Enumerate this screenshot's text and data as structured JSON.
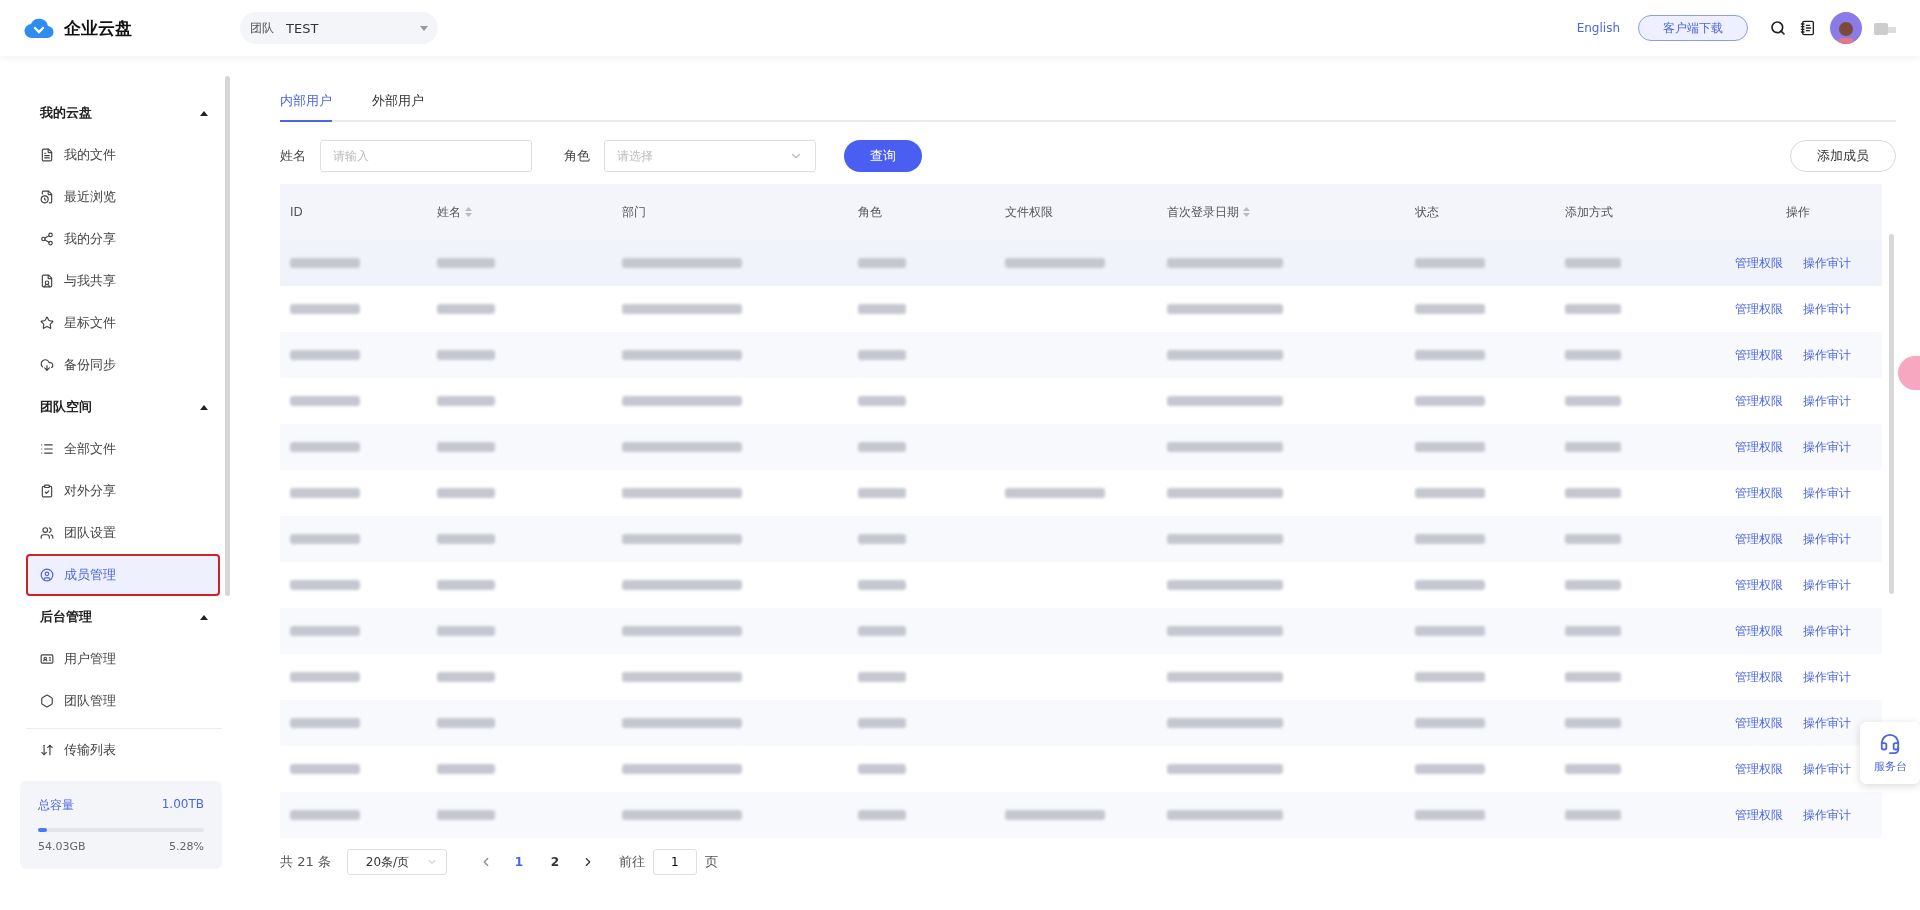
{
  "header": {
    "logo": "企业云盘",
    "team_label": "团队",
    "team_value": "TEST",
    "language": "English",
    "download": "客户端下载"
  },
  "sidebar": {
    "groups": [
      {
        "title": "我的云盘",
        "expanded": true,
        "items": [
          {
            "label": "我的文件",
            "selected": false
          },
          {
            "label": "最近浏览",
            "selected": false
          },
          {
            "label": "我的分享",
            "selected": false
          },
          {
            "label": "与我共享",
            "selected": false
          },
          {
            "label": "星标文件",
            "selected": false
          },
          {
            "label": "备份同步",
            "selected": false
          }
        ]
      },
      {
        "title": "团队空间",
        "expanded": true,
        "items": [
          {
            "label": "全部文件",
            "selected": false
          },
          {
            "label": "对外分享",
            "selected": false
          },
          {
            "label": "团队设置",
            "selected": false
          },
          {
            "label": "成员管理",
            "selected": true
          }
        ]
      },
      {
        "title": "后台管理",
        "expanded": true,
        "items": [
          {
            "label": "用户管理",
            "selected": false
          },
          {
            "label": "团队管理",
            "selected": false
          }
        ]
      }
    ],
    "transfer": "传输列表",
    "storage": {
      "label": "总容量",
      "total": "1.00TB",
      "used": "54.03GB",
      "percent": "5.28%",
      "level": 0.0528
    }
  },
  "tabs": [
    {
      "label": "内部用户",
      "selected": true
    },
    {
      "label": "外部用户",
      "selected": false
    }
  ],
  "filters": {
    "name_label": "姓名",
    "name_placeholder": "请输入",
    "role_label": "角色",
    "role_placeholder": "请选择",
    "search": "查询",
    "add": "添加成员"
  },
  "table": {
    "columns": [
      {
        "label": "ID",
        "sortable": false
      },
      {
        "label": "姓名",
        "sortable": true
      },
      {
        "label": "部门",
        "sortable": false
      },
      {
        "label": "角色",
        "sortable": false
      },
      {
        "label": "文件权限",
        "sortable": false
      },
      {
        "label": "首次登录日期",
        "sortable": true
      },
      {
        "label": "状态",
        "sortable": false
      },
      {
        "label": "添加方式",
        "sortable": false
      },
      {
        "label": "操作",
        "sortable": false
      }
    ],
    "rows": [
      {
        "has_permissions": true,
        "actions": [
          "管理权限",
          "操作审计"
        ]
      },
      {
        "has_permissions": false,
        "actions": [
          "管理权限",
          "操作审计"
        ]
      },
      {
        "has_permissions": false,
        "actions": [
          "管理权限",
          "操作审计"
        ]
      },
      {
        "has_permissions": false,
        "actions": [
          "管理权限",
          "操作审计"
        ]
      },
      {
        "has_permissions": false,
        "actions": [
          "管理权限",
          "操作审计"
        ]
      },
      {
        "has_permissions": true,
        "actions": [
          "管理权限",
          "操作审计"
        ]
      },
      {
        "has_permissions": false,
        "actions": [
          "管理权限",
          "操作审计"
        ]
      },
      {
        "has_permissions": false,
        "actions": [
          "管理权限",
          "操作审计"
        ]
      },
      {
        "has_permissions": false,
        "actions": [
          "管理权限",
          "操作审计"
        ]
      },
      {
        "has_permissions": false,
        "actions": [
          "管理权限",
          "操作审计"
        ]
      },
      {
        "has_permissions": false,
        "actions": [
          "管理权限",
          "操作审计"
        ]
      },
      {
        "has_permissions": false,
        "actions": [
          "管理权限",
          "操作审计"
        ]
      },
      {
        "has_permissions": true,
        "actions": [
          "管理权限",
          "操作审计"
        ]
      }
    ]
  },
  "pagination": {
    "total": "共 21 条",
    "page_size": "20条/页",
    "pages": [
      {
        "label": "1",
        "selected": true
      },
      {
        "label": "2",
        "selected": false
      }
    ],
    "goto": "前往",
    "goto_value": "1",
    "page_unit": "页"
  },
  "service_desk": "服务台"
}
